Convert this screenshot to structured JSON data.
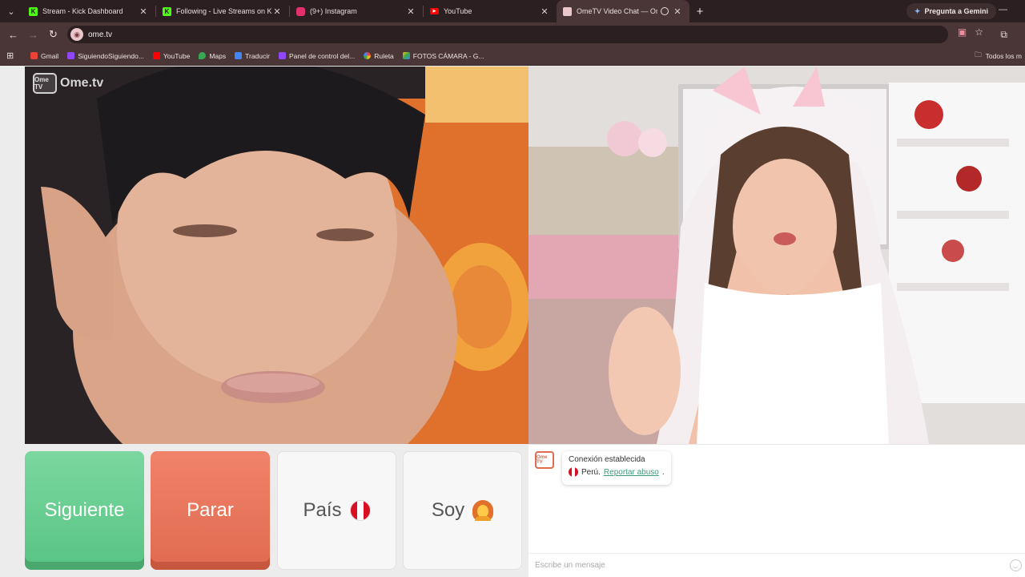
{
  "browser": {
    "tabs": [
      {
        "title": "Stream - Kick Dashboard",
        "favicon": "kick-icon",
        "color": "#53fc18"
      },
      {
        "title": "Following - Live Streams on Kick",
        "favicon": "kick-icon",
        "color": "#53fc18"
      },
      {
        "title": "(9+) Instagram",
        "favicon": "instagram-icon",
        "color": "#e1306c"
      },
      {
        "title": "YouTube",
        "favicon": "youtube-icon",
        "color": "#ff0000"
      },
      {
        "title": "OmeTV Video Chat — Omegle",
        "favicon": "ometv-icon",
        "color": "#e9c7cb",
        "active": true
      }
    ],
    "gemini_label": "Pregunta a Gemini",
    "url": "ome.tv",
    "bookmarks": [
      {
        "label": "Gmail",
        "color": "#ea4335"
      },
      {
        "label": "SiguiendoSiguiendo...",
        "color": "#9146ff"
      },
      {
        "label": "YouTube",
        "color": "#ff0000"
      },
      {
        "label": "Maps",
        "color": "#34a853"
      },
      {
        "label": "Traducir",
        "color": "#4285f4"
      },
      {
        "label": "Panel de control del...",
        "color": "#9146ff"
      },
      {
        "label": "Ruleta",
        "color": "#fbbc05"
      },
      {
        "label": "FOTOS CÁMARA - G...",
        "color": "#34a853"
      }
    ],
    "bookmarks_folder": "Todos los m"
  },
  "app": {
    "logo_text": "Ome.tv",
    "logo_badge": "Ome TV",
    "buttons": {
      "next": "Siguiente",
      "stop": "Parar",
      "country": "País",
      "gender": "Soy"
    },
    "chat": {
      "status": "Conexión establecida",
      "country": "Perú.",
      "report_link": "Reportar abuso",
      "placeholder": "Escribe un mensaje"
    }
  }
}
